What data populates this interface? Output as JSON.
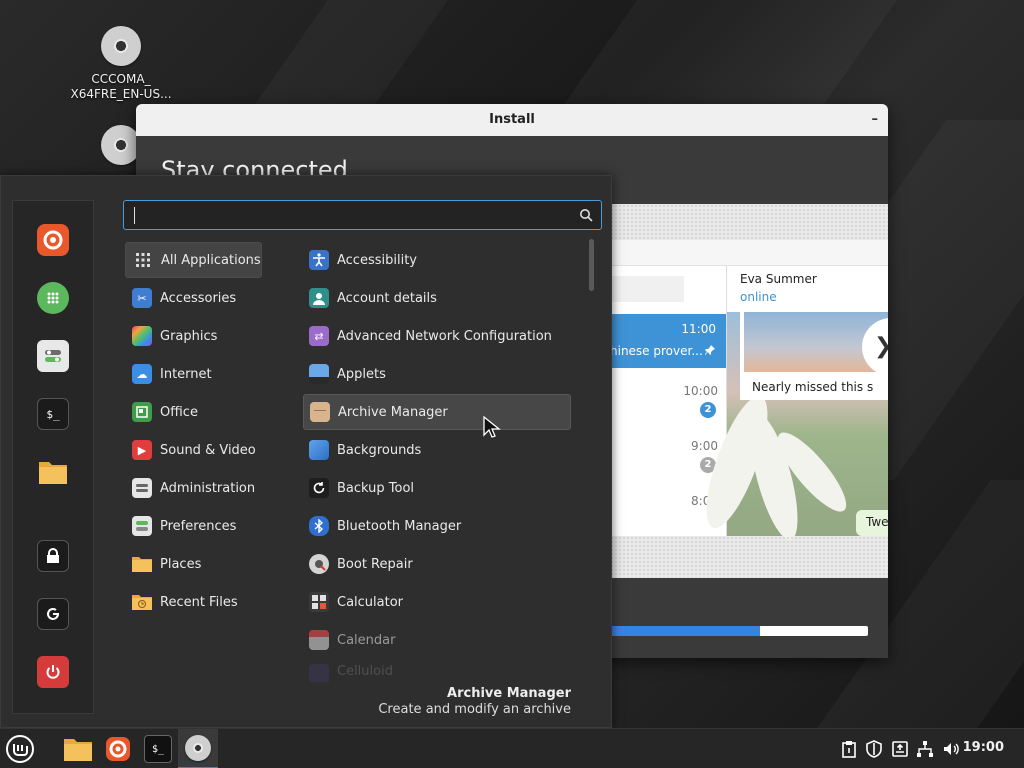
{
  "desktop": {
    "icons": [
      {
        "label_line1": "CCCOMA_",
        "label_line2": "X64FRE_EN-US..."
      }
    ]
  },
  "install_window": {
    "title": "Install",
    "minimize": "–",
    "heading": "Stay connected",
    "slide": {
      "contact_name": "Eva Summer",
      "contact_status": "online",
      "selected_chat_time": "11:00",
      "selected_chat_preview": "hinese prover...",
      "chat_times": [
        "10:00",
        "9:00",
        "8:00"
      ],
      "badges": [
        "2",
        "2"
      ],
      "photo_caption": "Nearly missed this s",
      "bubble_text": "Twe",
      "next_arrow": "❯"
    },
    "progress": 0.58
  },
  "menu": {
    "search": {
      "value": "",
      "placeholder": ""
    },
    "favorites": [
      {
        "name": "firefox-icon"
      },
      {
        "name": "software-manager-icon"
      },
      {
        "name": "system-settings-icon"
      },
      {
        "name": "terminal-icon"
      },
      {
        "name": "files-icon"
      },
      {
        "name": "lock-screen-icon"
      },
      {
        "name": "logout-icon"
      },
      {
        "name": "power-icon"
      }
    ],
    "categories": [
      {
        "label": "All Applications",
        "icon": "grid-icon"
      },
      {
        "label": "Accessories",
        "icon": "scissors-icon"
      },
      {
        "label": "Graphics",
        "icon": "graphics-icon"
      },
      {
        "label": "Internet",
        "icon": "cloud-icon"
      },
      {
        "label": "Office",
        "icon": "office-icon"
      },
      {
        "label": "Sound & Video",
        "icon": "play-icon"
      },
      {
        "label": "Administration",
        "icon": "admin-icon"
      },
      {
        "label": "Preferences",
        "icon": "preferences-icon"
      },
      {
        "label": "Places",
        "icon": "folder-icon"
      },
      {
        "label": "Recent Files",
        "icon": "recent-folder-icon"
      }
    ],
    "apps": [
      {
        "label": "Accessibility",
        "icon": "accessibility-icon"
      },
      {
        "label": "Account details",
        "icon": "account-icon"
      },
      {
        "label": "Advanced Network Configuration",
        "icon": "network-config-icon"
      },
      {
        "label": "Applets",
        "icon": "applets-icon"
      },
      {
        "label": "Archive Manager",
        "icon": "archive-icon"
      },
      {
        "label": "Backgrounds",
        "icon": "backgrounds-icon"
      },
      {
        "label": "Backup Tool",
        "icon": "backup-icon"
      },
      {
        "label": "Bluetooth Manager",
        "icon": "bluetooth-icon"
      },
      {
        "label": "Boot Repair",
        "icon": "boot-repair-icon"
      },
      {
        "label": "Calculator",
        "icon": "calculator-icon"
      },
      {
        "label": "Calendar",
        "icon": "calendar-icon"
      },
      {
        "label": "Celluloid",
        "icon": "celluloid-icon"
      }
    ],
    "description": {
      "title": "Archive Manager",
      "text": "Create and modify an archive"
    }
  },
  "taskbar": {
    "clock": "19:00",
    "tray": [
      "clipboard-icon",
      "shield-icon",
      "updates-icon",
      "network-icon",
      "volume-icon"
    ]
  },
  "colors": {
    "accent": "#3584e4",
    "menu_bg": "#2e2e2e",
    "selected_chat": "#3e93d6"
  }
}
